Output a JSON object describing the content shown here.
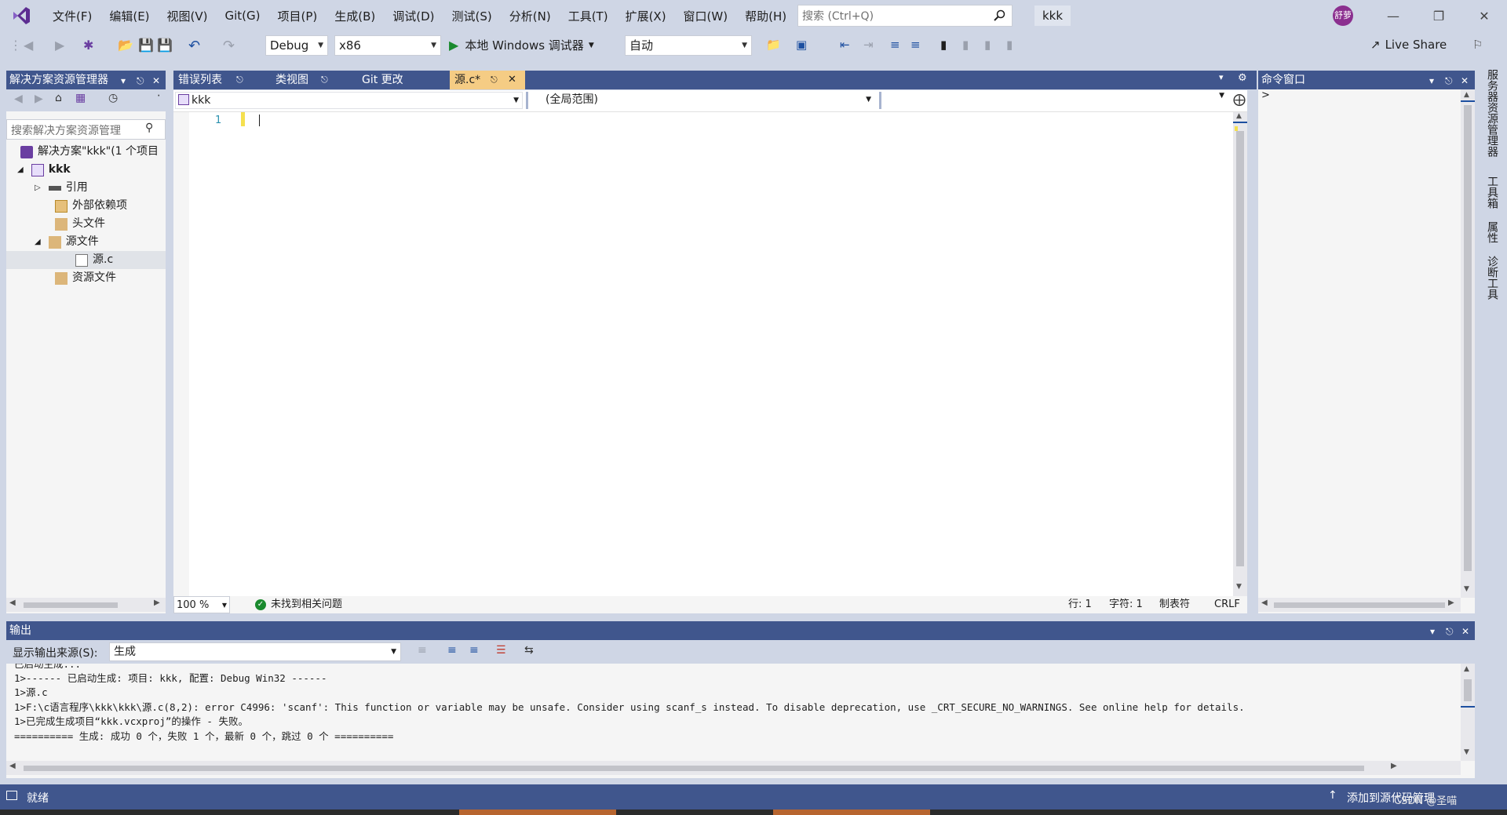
{
  "menu": {
    "items": [
      "文件(F)",
      "编辑(E)",
      "视图(V)",
      "Git(G)",
      "项目(P)",
      "生成(B)",
      "调试(D)",
      "测试(S)",
      "分析(N)",
      "工具(T)",
      "扩展(X)",
      "窗口(W)",
      "帮助(H)"
    ],
    "search_placeholder": "搜索 (Ctrl+Q)",
    "solution_name": "kkk",
    "avatar_text": "舒萝"
  },
  "toolbar": {
    "config": "Debug",
    "platform": "x86",
    "run_label": "本地 Windows 调试器",
    "auto_label": "自动",
    "live_share": "Live Share"
  },
  "solution_explorer": {
    "title": "解决方案资源管理器",
    "search_placeholder": "搜索解决方案资源管理",
    "tree": [
      {
        "label": "解决方案\"kkk\"(1 个项目"
      },
      {
        "label": "kkk"
      },
      {
        "label": "引用"
      },
      {
        "label": "外部依赖项"
      },
      {
        "label": "头文件"
      },
      {
        "label": "源文件"
      },
      {
        "label": "源.c"
      },
      {
        "label": "资源文件"
      }
    ]
  },
  "editor": {
    "tabs": [
      "错误列表",
      "类视图",
      "Git 更改",
      "源.c*"
    ],
    "nav_project": "kkk",
    "nav_scope": "(全局范围)",
    "line_number": "1",
    "zoom": "100 %",
    "issues": "未找到相关问题",
    "row": "行: 1",
    "col": "字符: 1",
    "tab_mode": "制表符",
    "eol": "CRLF"
  },
  "command_window": {
    "title": "命令窗口",
    "prompt": ">"
  },
  "right_tabs": [
    "服务器资源管理器",
    "工具箱",
    "属性",
    "诊断工具"
  ],
  "output": {
    "title": "输出",
    "source_label": "显示输出来源(S):",
    "source_value": "生成",
    "lines": [
      "已启动生成...",
      "1>------ 已启动生成: 项目: kkk, 配置: Debug Win32 ------",
      "1>源.c",
      "1>F:\\c语言程序\\kkk\\kkk\\源.c(8,2): error C4996: 'scanf': This function or variable may be unsafe. Consider using scanf_s instead. To disable deprecation, use _CRT_SECURE_NO_WARNINGS. See online help for details.",
      "1>已完成生成项目“kkk.vcxproj”的操作 - 失败。",
      "========== 生成: 成功 0 个，失败 1 个，最新 0 个，跳过 0 个 =========="
    ]
  },
  "status": {
    "ready": "就绪",
    "source_control": "添加到源代码管理",
    "watermark": "CSDN @圣喵"
  }
}
